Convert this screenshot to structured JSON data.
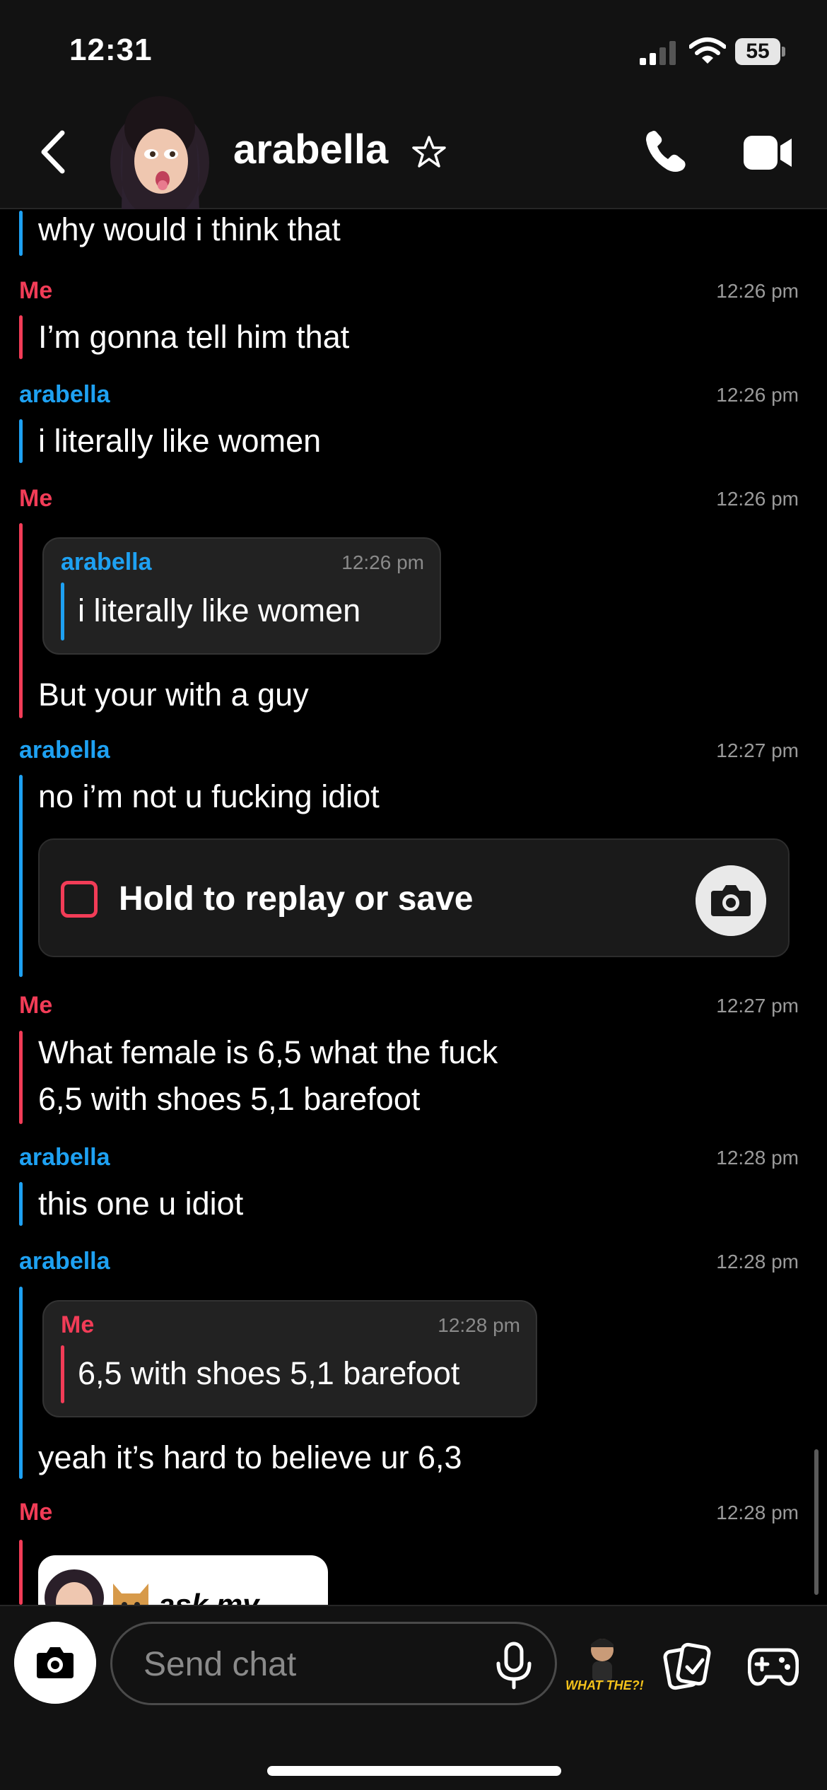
{
  "status_bar": {
    "time": "12:31",
    "battery": "55"
  },
  "header": {
    "contact_name": "arabella",
    "icons": [
      "back-chevron-icon",
      "star-outline-icon",
      "phone-icon",
      "video-camera-icon"
    ]
  },
  "messages": [
    {
      "sender": "",
      "time": "",
      "text": "why would i think that"
    },
    {
      "sender": "Me",
      "time": "12:26 pm",
      "text": "I’m gonna tell him that"
    },
    {
      "sender": "arabella",
      "time": "12:26 pm",
      "text": "i literally like women"
    },
    {
      "sender": "Me",
      "time": "12:26 pm",
      "quote": {
        "sender": "arabella",
        "time": "12:26 pm",
        "text": "i literally like women"
      },
      "text": "But your with a guy"
    },
    {
      "sender": "arabella",
      "time": "12:27 pm",
      "text": "no i’m not u fucking idiot",
      "snap_label": "Hold to replay or save"
    },
    {
      "sender": "Me",
      "time": "12:27 pm",
      "text_line1": "What female is 6,5 what the fuck",
      "text_line2": "6,5 with shoes 5,1 barefoot"
    },
    {
      "sender": "arabella",
      "time": "12:28 pm",
      "text": "this one u idiot"
    },
    {
      "sender": "arabella",
      "time": "12:28 pm",
      "quote": {
        "sender": "Me",
        "time": "12:28 pm",
        "text": "6,5 with shoes 5,1 barefoot"
      },
      "text": "yeah it’s hard to believe ur 6,3"
    },
    {
      "sender": "Me",
      "time": "12:28 pm",
      "sticker_text": "ask my crush"
    }
  ],
  "composer": {
    "placeholder": "Send chat",
    "bitmoji_caption": "WHAT THE?!"
  },
  "colors": {
    "me": "#f23c57",
    "friend": "#1ea1f2",
    "background": "#000000",
    "bar": "#121212"
  }
}
